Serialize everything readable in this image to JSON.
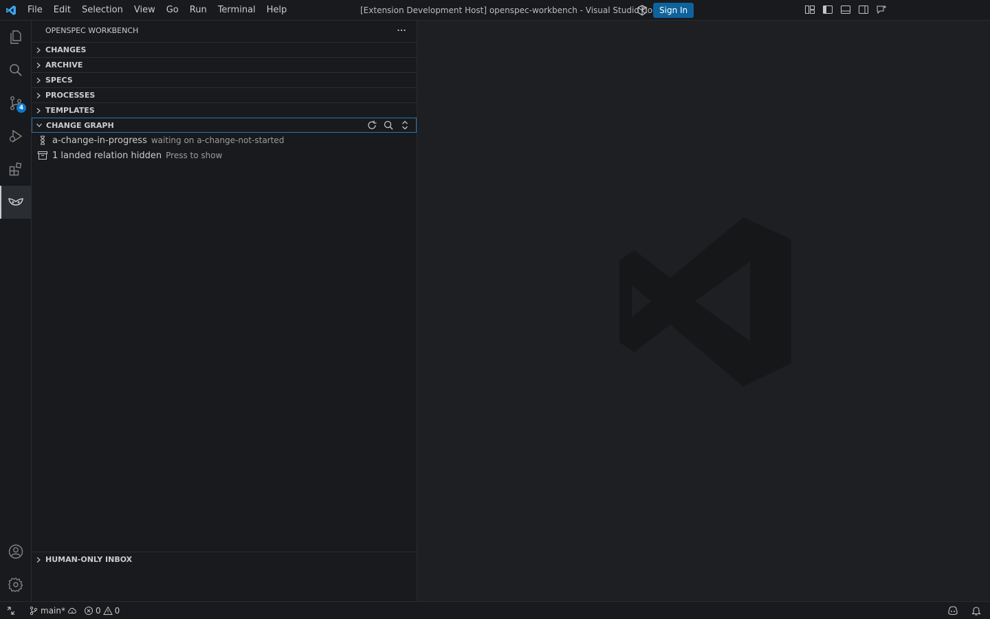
{
  "titlebar": {
    "menu": [
      "File",
      "Edit",
      "Selection",
      "View",
      "Go",
      "Run",
      "Terminal",
      "Help"
    ],
    "window_title": "[Extension Development Host] openspec-workbench - Visual Studio Code",
    "sign_in_label": "Sign In",
    "accent_color": "#0e639c"
  },
  "activitybar": {
    "items": [
      "explorer-icon",
      "search-icon",
      "source-control-icon",
      "run-debug-icon",
      "extensions-icon",
      "openspec-icon",
      "account-icon",
      "settings-gear-icon"
    ],
    "source_control_badge": "4",
    "active": "openspec-icon"
  },
  "sidebar": {
    "title": "OPENSPEC WORKBENCH",
    "sections": {
      "changes": "CHANGES",
      "archive": "ARCHIVE",
      "specs": "SPECS",
      "processes": "PROCESSES",
      "templates": "TEMPLATES",
      "change_graph": "CHANGE GRAPH",
      "human_inbox": "HUMAN-ONLY INBOX"
    },
    "change_graph_items": [
      {
        "label": "a-change-in-progress",
        "description": "waiting on a-change-not-started"
      },
      {
        "label": "1 landed relation hidden",
        "description": "Press to show"
      }
    ]
  },
  "statusbar": {
    "branch": "main*",
    "errors": "0",
    "warnings": "0"
  }
}
